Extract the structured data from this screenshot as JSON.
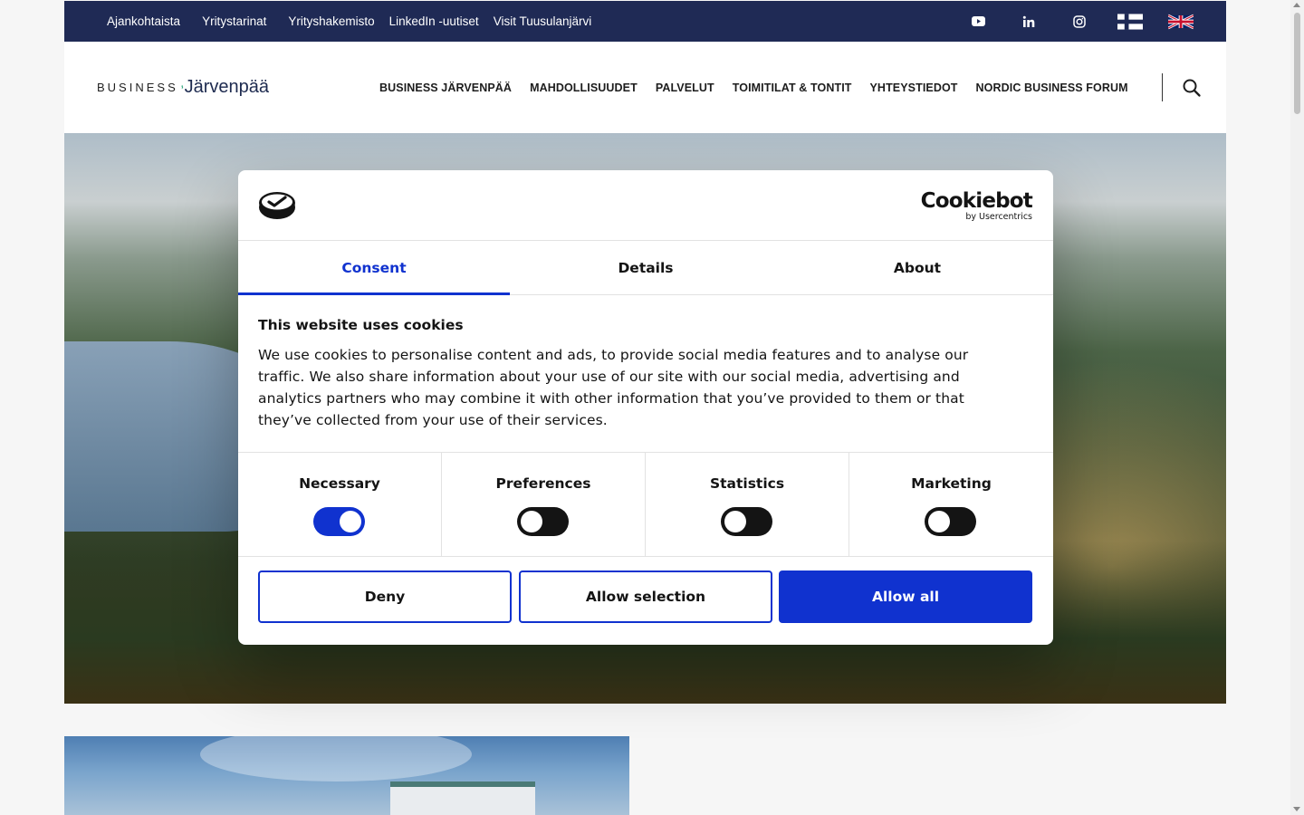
{
  "topbar": {
    "links": [
      "Ajankohtaista",
      "Yritystarinat",
      "Yrityshakemisto",
      "LinkedIn -uutiset",
      "Visit Tuusulanjärvi"
    ],
    "icons": [
      "youtube-icon",
      "linkedin-icon",
      "instagram-icon",
      "finnish-flag-icon",
      "uk-flag-icon"
    ]
  },
  "header": {
    "logo_business": "BUSINESS",
    "logo_city": "Järvenpää",
    "nav": [
      "BUSINESS JÄRVENPÄÄ",
      "MAHDOLLISUUDET",
      "PALVELUT",
      "TOIMITILAT & TONTIT",
      "YHTEYSTIEDOT",
      "NORDIC BUSINESS FORUM"
    ]
  },
  "cookie_dialog": {
    "brand": "Cookiebot",
    "brand_sub": "by Usercentrics",
    "tabs": [
      "Consent",
      "Details",
      "About"
    ],
    "active_tab": "Consent",
    "title": "This website uses cookies",
    "body": "We use cookies to personalise content and ads, to provide social media features and to analyse our traffic. We also share information about your use of our site with our social media, advertising and analytics partners who may combine it with other information that you’ve provided to them or that they’ve collected from your use of their services.",
    "categories": [
      {
        "label": "Necessary",
        "enabled": true
      },
      {
        "label": "Preferences",
        "enabled": false
      },
      {
        "label": "Statistics",
        "enabled": false
      },
      {
        "label": "Marketing",
        "enabled": false
      }
    ],
    "buttons": {
      "deny": "Deny",
      "allow_selection": "Allow selection",
      "allow_all": "Allow all"
    }
  },
  "colors": {
    "topbar_bg": "#1f2a55",
    "accent": "#1032cf",
    "logo_green": "#2aa37a"
  }
}
